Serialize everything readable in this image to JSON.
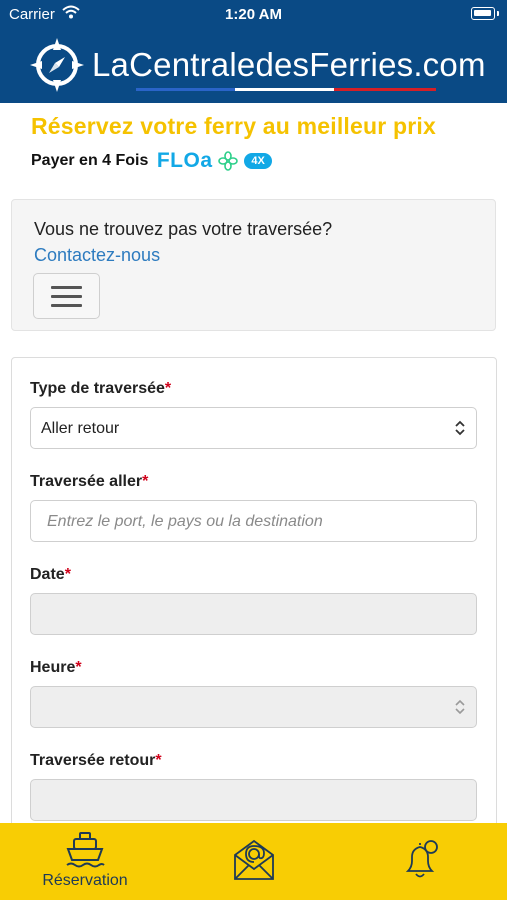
{
  "status_bar": {
    "carrier": "Carrier",
    "time": "1:20 AM"
  },
  "header": {
    "site_name": "LaCentraledesFerries.com"
  },
  "promo": {
    "title": "Réservez votre ferry au meilleur prix",
    "pay_text": "Payer en 4 Fois",
    "floa_logo": "FLOa",
    "floa_badge": "4X"
  },
  "notice": {
    "text": "Vous ne trouvez pas votre traversée?",
    "link": "Contactez-nous"
  },
  "form": {
    "trip_type": {
      "label": "Type de traversée",
      "required_mark": "*",
      "value": "Aller retour"
    },
    "outbound": {
      "label": "Traversée aller",
      "required_mark": "*",
      "placeholder": "Entrez le port, le pays ou la destination"
    },
    "date": {
      "label": "Date",
      "required_mark": "*",
      "value": ""
    },
    "time": {
      "label": "Heure",
      "required_mark": "*",
      "value": ""
    },
    "return": {
      "label": "Traversée retour",
      "required_mark": "*",
      "value": ""
    }
  },
  "tabbar": {
    "items": [
      {
        "label": "Réservation",
        "icon": "ferry-icon",
        "active": true
      },
      {
        "label": "",
        "icon": "email-icon",
        "active": false
      },
      {
        "label": "",
        "icon": "bell-icon",
        "active": false
      }
    ]
  },
  "colors": {
    "header_bg": "#0a4a85",
    "accent_yellow": "#f5c200",
    "tabbar_bg": "#f8cd04",
    "link_blue": "#2d7bbf",
    "floa_blue": "#12a8e6",
    "required_red": "#d0021b"
  }
}
